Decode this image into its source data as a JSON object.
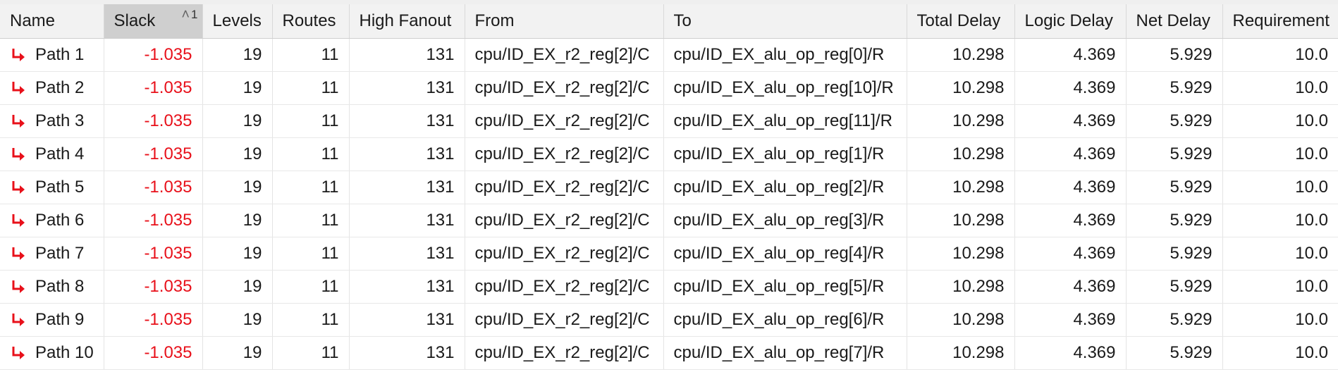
{
  "table": {
    "columns": [
      {
        "key": "name",
        "label": "Name"
      },
      {
        "key": "slack",
        "label": "Slack"
      },
      {
        "key": "levels",
        "label": "Levels"
      },
      {
        "key": "routes",
        "label": "Routes"
      },
      {
        "key": "high_fanout",
        "label": "High Fanout"
      },
      {
        "key": "from",
        "label": "From"
      },
      {
        "key": "to",
        "label": "To"
      },
      {
        "key": "total_delay",
        "label": "Total Delay"
      },
      {
        "key": "logic_delay",
        "label": "Logic Delay"
      },
      {
        "key": "net_delay",
        "label": "Net Delay"
      },
      {
        "key": "requirement",
        "label": "Requirement"
      }
    ],
    "sort": {
      "column": "Slack",
      "direction": "ascending",
      "order": "1",
      "caret_icon": "caret-up-icon"
    },
    "row_icon": "failing-path-arrow-icon",
    "colors": {
      "slack_negative": "#e8101a",
      "path_icon": "#e8101a"
    },
    "rows": [
      {
        "name": "Path 1",
        "slack": "-1.035",
        "levels": "19",
        "routes": "11",
        "high_fanout": "131",
        "from": "cpu/ID_EX_r2_reg[2]/C",
        "to": "cpu/ID_EX_alu_op_reg[0]/R",
        "total_delay": "10.298",
        "logic_delay": "4.369",
        "net_delay": "5.929",
        "requirement": "10.0"
      },
      {
        "name": "Path 2",
        "slack": "-1.035",
        "levels": "19",
        "routes": "11",
        "high_fanout": "131",
        "from": "cpu/ID_EX_r2_reg[2]/C",
        "to": "cpu/ID_EX_alu_op_reg[10]/R",
        "total_delay": "10.298",
        "logic_delay": "4.369",
        "net_delay": "5.929",
        "requirement": "10.0"
      },
      {
        "name": "Path 3",
        "slack": "-1.035",
        "levels": "19",
        "routes": "11",
        "high_fanout": "131",
        "from": "cpu/ID_EX_r2_reg[2]/C",
        "to": "cpu/ID_EX_alu_op_reg[11]/R",
        "total_delay": "10.298",
        "logic_delay": "4.369",
        "net_delay": "5.929",
        "requirement": "10.0"
      },
      {
        "name": "Path 4",
        "slack": "-1.035",
        "levels": "19",
        "routes": "11",
        "high_fanout": "131",
        "from": "cpu/ID_EX_r2_reg[2]/C",
        "to": "cpu/ID_EX_alu_op_reg[1]/R",
        "total_delay": "10.298",
        "logic_delay": "4.369",
        "net_delay": "5.929",
        "requirement": "10.0"
      },
      {
        "name": "Path 5",
        "slack": "-1.035",
        "levels": "19",
        "routes": "11",
        "high_fanout": "131",
        "from": "cpu/ID_EX_r2_reg[2]/C",
        "to": "cpu/ID_EX_alu_op_reg[2]/R",
        "total_delay": "10.298",
        "logic_delay": "4.369",
        "net_delay": "5.929",
        "requirement": "10.0"
      },
      {
        "name": "Path 6",
        "slack": "-1.035",
        "levels": "19",
        "routes": "11",
        "high_fanout": "131",
        "from": "cpu/ID_EX_r2_reg[2]/C",
        "to": "cpu/ID_EX_alu_op_reg[3]/R",
        "total_delay": "10.298",
        "logic_delay": "4.369",
        "net_delay": "5.929",
        "requirement": "10.0"
      },
      {
        "name": "Path 7",
        "slack": "-1.035",
        "levels": "19",
        "routes": "11",
        "high_fanout": "131",
        "from": "cpu/ID_EX_r2_reg[2]/C",
        "to": "cpu/ID_EX_alu_op_reg[4]/R",
        "total_delay": "10.298",
        "logic_delay": "4.369",
        "net_delay": "5.929",
        "requirement": "10.0"
      },
      {
        "name": "Path 8",
        "slack": "-1.035",
        "levels": "19",
        "routes": "11",
        "high_fanout": "131",
        "from": "cpu/ID_EX_r2_reg[2]/C",
        "to": "cpu/ID_EX_alu_op_reg[5]/R",
        "total_delay": "10.298",
        "logic_delay": "4.369",
        "net_delay": "5.929",
        "requirement": "10.0"
      },
      {
        "name": "Path 9",
        "slack": "-1.035",
        "levels": "19",
        "routes": "11",
        "high_fanout": "131",
        "from": "cpu/ID_EX_r2_reg[2]/C",
        "to": "cpu/ID_EX_alu_op_reg[6]/R",
        "total_delay": "10.298",
        "logic_delay": "4.369",
        "net_delay": "5.929",
        "requirement": "10.0"
      },
      {
        "name": "Path 10",
        "slack": "-1.035",
        "levels": "19",
        "routes": "11",
        "high_fanout": "131",
        "from": "cpu/ID_EX_r2_reg[2]/C",
        "to": "cpu/ID_EX_alu_op_reg[7]/R",
        "total_delay": "10.298",
        "logic_delay": "4.369",
        "net_delay": "5.929",
        "requirement": "10.0"
      }
    ]
  }
}
